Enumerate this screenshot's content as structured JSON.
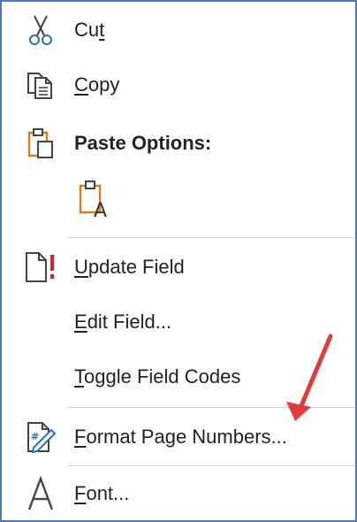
{
  "menu": {
    "items": [
      {
        "pre": "Cu",
        "key": "t",
        "post": ""
      },
      {
        "pre": "",
        "key": "C",
        "post": "opy"
      },
      {
        "pre": "",
        "key": "",
        "post": "Paste Options:"
      },
      {
        "pre": "",
        "key": "U",
        "post": "pdate Field"
      },
      {
        "pre": "",
        "key": "E",
        "post": "dit Field..."
      },
      {
        "pre": "",
        "key": "T",
        "post": "oggle Field Codes"
      },
      {
        "pre": "",
        "key": "F",
        "post": "ormat Page Numbers..."
      },
      {
        "pre": "",
        "key": "F",
        "post": "ont..."
      }
    ]
  },
  "colors": {
    "border": "#4a78b8",
    "accent_orange": "#d97b1f",
    "error_red": "#d9202a",
    "arrow_red": "#e23b3b",
    "icon_gray": "#444444"
  },
  "icons": {
    "cut": "scissors-icon",
    "copy": "copy-icon",
    "paste_options": "clipboard-icon",
    "paste_keep_text": "paste-keep-text-only-icon",
    "update_field": "update-field-icon",
    "format_page_numbers": "format-page-numbers-icon",
    "font": "font-icon"
  }
}
